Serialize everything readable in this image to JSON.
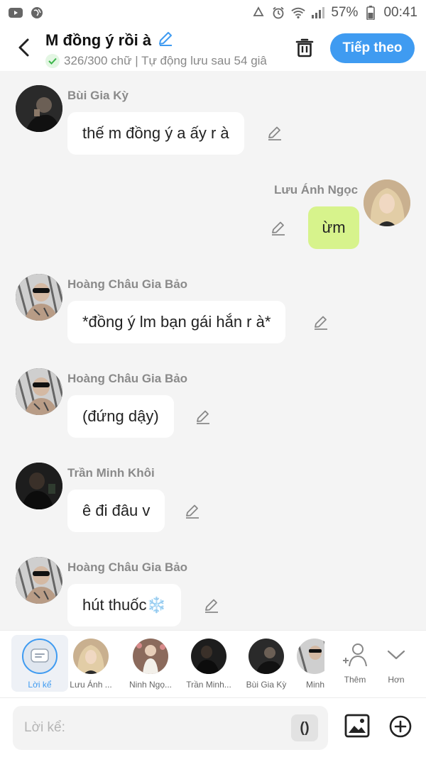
{
  "status": {
    "battery": "57%",
    "time": "00:41"
  },
  "header": {
    "title": "M đồng ý rồi à",
    "subtitle": "326/300 chữ | Tự động lưu sau 54 giâ",
    "next_label": "Tiếp theo"
  },
  "messages": [
    {
      "sender": "Bùi Gia Kỳ",
      "text": "thế m đồng ý a ấy r à",
      "side": "left"
    },
    {
      "sender": "Lưu Ánh Ngọc",
      "text": "ừm",
      "side": "right"
    },
    {
      "sender": "Hoàng Châu Gia Bảo",
      "text": "*đồng ý lm bạn gái hắn r à*",
      "side": "left"
    },
    {
      "sender": "Hoàng Châu Gia Bảo",
      "text": "(đứng dậy)",
      "side": "left"
    },
    {
      "sender": "Trần Minh Khôi",
      "text": "ê đi đâu v",
      "side": "left"
    },
    {
      "sender": "Hoàng Châu Gia Bảo",
      "text": "hút thuốc❄️",
      "side": "left"
    }
  ],
  "characters": [
    {
      "name": "Lời kể"
    },
    {
      "name": "Lưu Ánh ..."
    },
    {
      "name": "Ninh Ngọ..."
    },
    {
      "name": "Trần Minh..."
    },
    {
      "name": "Bùi Gia Kỳ"
    },
    {
      "name": "Minh"
    }
  ],
  "actions": {
    "add_label": "Thêm",
    "more_label": "Hơn"
  },
  "input": {
    "placeholder": "Lời kể:",
    "paren_label": "()"
  },
  "colors": {
    "accent": "#3f9bf1",
    "my_bubble": "#d7f38c",
    "other_bubble": "#ffffff",
    "background": "#f4f4f4"
  }
}
